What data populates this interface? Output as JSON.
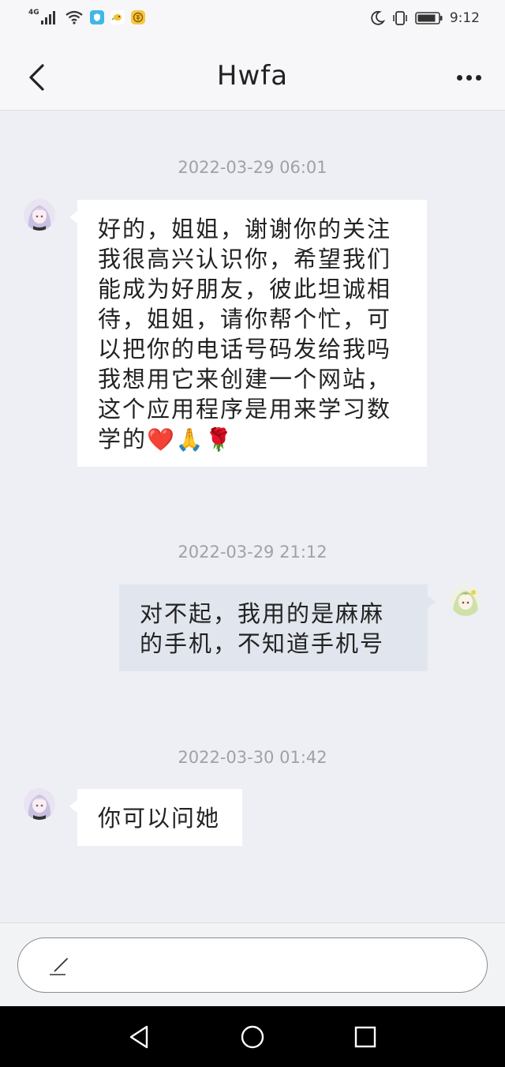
{
  "status_bar": {
    "network": "4G",
    "time": "9:12"
  },
  "header": {
    "title": "Hwfa"
  },
  "messages": [
    {
      "timestamp": "2022-03-29 06:01",
      "direction": "incoming",
      "lines": [
        "好的，姐姐，谢谢你的关注",
        "我很高兴认识你，希望我们",
        "能成为好朋友，彼此坦诚相",
        "待，姐姐，请你帮个忙，可",
        "以把你的电话号码发给我吗",
        "我想用它来创建一个网站，",
        "这个应用程序是用来学习数",
        "学的"
      ],
      "emojis": "❤️🙏🌹"
    },
    {
      "timestamp": "2022-03-29 21:12",
      "direction": "outgoing",
      "lines": [
        "对不起，我用的是麻麻",
        "的手机，不知道手机号"
      ]
    },
    {
      "timestamp": "2022-03-30 01:42",
      "direction": "incoming",
      "lines": [
        "你可以问她"
      ]
    }
  ],
  "input": {
    "icon": "pencil-icon"
  },
  "nav": {
    "icons": [
      "back-triangle-icon",
      "home-circle-icon",
      "recents-square-icon"
    ]
  }
}
